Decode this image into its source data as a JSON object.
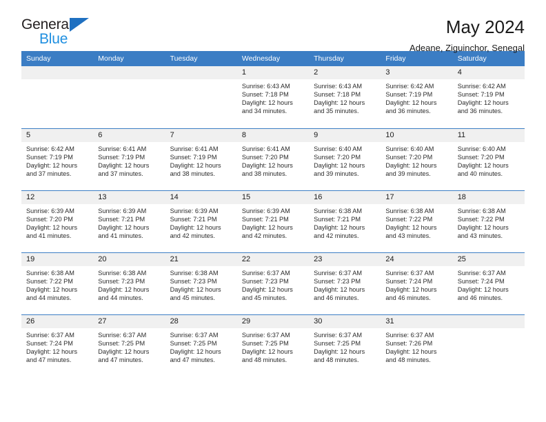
{
  "brand": {
    "name_top": "General",
    "name_bottom": "Blue",
    "triangle_color": "#1f70c1",
    "blue_text_color": "#1f8fe0"
  },
  "header": {
    "title": "May 2024",
    "subtitle": "Adeane, Ziguinchor, Senegal"
  },
  "theme": {
    "header_bg": "#3b7dc4",
    "daynum_bg": "#f0f0f0",
    "row_divider": "#3b7dc4"
  },
  "weekdays": [
    "Sunday",
    "Monday",
    "Tuesday",
    "Wednesday",
    "Thursday",
    "Friday",
    "Saturday"
  ],
  "weeks": [
    [
      {
        "day": "",
        "empty": true
      },
      {
        "day": "",
        "empty": true
      },
      {
        "day": "",
        "empty": true
      },
      {
        "day": "1",
        "sunrise": "Sunrise: 6:43 AM",
        "sunset": "Sunset: 7:18 PM",
        "daylight1": "Daylight: 12 hours",
        "daylight2": "and 34 minutes."
      },
      {
        "day": "2",
        "sunrise": "Sunrise: 6:43 AM",
        "sunset": "Sunset: 7:18 PM",
        "daylight1": "Daylight: 12 hours",
        "daylight2": "and 35 minutes."
      },
      {
        "day": "3",
        "sunrise": "Sunrise: 6:42 AM",
        "sunset": "Sunset: 7:19 PM",
        "daylight1": "Daylight: 12 hours",
        "daylight2": "and 36 minutes."
      },
      {
        "day": "4",
        "sunrise": "Sunrise: 6:42 AM",
        "sunset": "Sunset: 7:19 PM",
        "daylight1": "Daylight: 12 hours",
        "daylight2": "and 36 minutes."
      }
    ],
    [
      {
        "day": "5",
        "sunrise": "Sunrise: 6:42 AM",
        "sunset": "Sunset: 7:19 PM",
        "daylight1": "Daylight: 12 hours",
        "daylight2": "and 37 minutes."
      },
      {
        "day": "6",
        "sunrise": "Sunrise: 6:41 AM",
        "sunset": "Sunset: 7:19 PM",
        "daylight1": "Daylight: 12 hours",
        "daylight2": "and 37 minutes."
      },
      {
        "day": "7",
        "sunrise": "Sunrise: 6:41 AM",
        "sunset": "Sunset: 7:19 PM",
        "daylight1": "Daylight: 12 hours",
        "daylight2": "and 38 minutes."
      },
      {
        "day": "8",
        "sunrise": "Sunrise: 6:41 AM",
        "sunset": "Sunset: 7:20 PM",
        "daylight1": "Daylight: 12 hours",
        "daylight2": "and 38 minutes."
      },
      {
        "day": "9",
        "sunrise": "Sunrise: 6:40 AM",
        "sunset": "Sunset: 7:20 PM",
        "daylight1": "Daylight: 12 hours",
        "daylight2": "and 39 minutes."
      },
      {
        "day": "10",
        "sunrise": "Sunrise: 6:40 AM",
        "sunset": "Sunset: 7:20 PM",
        "daylight1": "Daylight: 12 hours",
        "daylight2": "and 39 minutes."
      },
      {
        "day": "11",
        "sunrise": "Sunrise: 6:40 AM",
        "sunset": "Sunset: 7:20 PM",
        "daylight1": "Daylight: 12 hours",
        "daylight2": "and 40 minutes."
      }
    ],
    [
      {
        "day": "12",
        "sunrise": "Sunrise: 6:39 AM",
        "sunset": "Sunset: 7:20 PM",
        "daylight1": "Daylight: 12 hours",
        "daylight2": "and 41 minutes."
      },
      {
        "day": "13",
        "sunrise": "Sunrise: 6:39 AM",
        "sunset": "Sunset: 7:21 PM",
        "daylight1": "Daylight: 12 hours",
        "daylight2": "and 41 minutes."
      },
      {
        "day": "14",
        "sunrise": "Sunrise: 6:39 AM",
        "sunset": "Sunset: 7:21 PM",
        "daylight1": "Daylight: 12 hours",
        "daylight2": "and 42 minutes."
      },
      {
        "day": "15",
        "sunrise": "Sunrise: 6:39 AM",
        "sunset": "Sunset: 7:21 PM",
        "daylight1": "Daylight: 12 hours",
        "daylight2": "and 42 minutes."
      },
      {
        "day": "16",
        "sunrise": "Sunrise: 6:38 AM",
        "sunset": "Sunset: 7:21 PM",
        "daylight1": "Daylight: 12 hours",
        "daylight2": "and 42 minutes."
      },
      {
        "day": "17",
        "sunrise": "Sunrise: 6:38 AM",
        "sunset": "Sunset: 7:22 PM",
        "daylight1": "Daylight: 12 hours",
        "daylight2": "and 43 minutes."
      },
      {
        "day": "18",
        "sunrise": "Sunrise: 6:38 AM",
        "sunset": "Sunset: 7:22 PM",
        "daylight1": "Daylight: 12 hours",
        "daylight2": "and 43 minutes."
      }
    ],
    [
      {
        "day": "19",
        "sunrise": "Sunrise: 6:38 AM",
        "sunset": "Sunset: 7:22 PM",
        "daylight1": "Daylight: 12 hours",
        "daylight2": "and 44 minutes."
      },
      {
        "day": "20",
        "sunrise": "Sunrise: 6:38 AM",
        "sunset": "Sunset: 7:23 PM",
        "daylight1": "Daylight: 12 hours",
        "daylight2": "and 44 minutes."
      },
      {
        "day": "21",
        "sunrise": "Sunrise: 6:38 AM",
        "sunset": "Sunset: 7:23 PM",
        "daylight1": "Daylight: 12 hours",
        "daylight2": "and 45 minutes."
      },
      {
        "day": "22",
        "sunrise": "Sunrise: 6:37 AM",
        "sunset": "Sunset: 7:23 PM",
        "daylight1": "Daylight: 12 hours",
        "daylight2": "and 45 minutes."
      },
      {
        "day": "23",
        "sunrise": "Sunrise: 6:37 AM",
        "sunset": "Sunset: 7:23 PM",
        "daylight1": "Daylight: 12 hours",
        "daylight2": "and 46 minutes."
      },
      {
        "day": "24",
        "sunrise": "Sunrise: 6:37 AM",
        "sunset": "Sunset: 7:24 PM",
        "daylight1": "Daylight: 12 hours",
        "daylight2": "and 46 minutes."
      },
      {
        "day": "25",
        "sunrise": "Sunrise: 6:37 AM",
        "sunset": "Sunset: 7:24 PM",
        "daylight1": "Daylight: 12 hours",
        "daylight2": "and 46 minutes."
      }
    ],
    [
      {
        "day": "26",
        "sunrise": "Sunrise: 6:37 AM",
        "sunset": "Sunset: 7:24 PM",
        "daylight1": "Daylight: 12 hours",
        "daylight2": "and 47 minutes."
      },
      {
        "day": "27",
        "sunrise": "Sunrise: 6:37 AM",
        "sunset": "Sunset: 7:25 PM",
        "daylight1": "Daylight: 12 hours",
        "daylight2": "and 47 minutes."
      },
      {
        "day": "28",
        "sunrise": "Sunrise: 6:37 AM",
        "sunset": "Sunset: 7:25 PM",
        "daylight1": "Daylight: 12 hours",
        "daylight2": "and 47 minutes."
      },
      {
        "day": "29",
        "sunrise": "Sunrise: 6:37 AM",
        "sunset": "Sunset: 7:25 PM",
        "daylight1": "Daylight: 12 hours",
        "daylight2": "and 48 minutes."
      },
      {
        "day": "30",
        "sunrise": "Sunrise: 6:37 AM",
        "sunset": "Sunset: 7:25 PM",
        "daylight1": "Daylight: 12 hours",
        "daylight2": "and 48 minutes."
      },
      {
        "day": "31",
        "sunrise": "Sunrise: 6:37 AM",
        "sunset": "Sunset: 7:26 PM",
        "daylight1": "Daylight: 12 hours",
        "daylight2": "and 48 minutes."
      },
      {
        "day": "",
        "empty": true
      }
    ]
  ]
}
